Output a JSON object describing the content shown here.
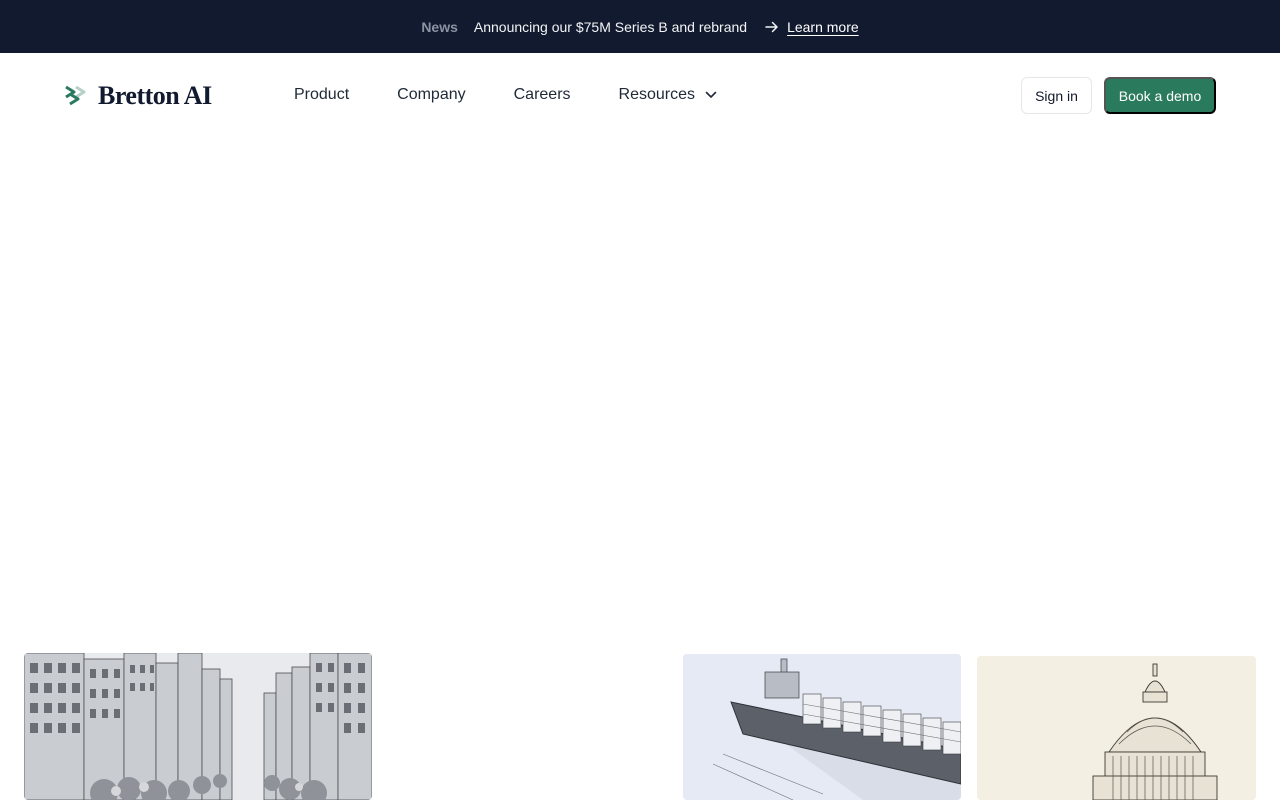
{
  "announcement": {
    "tag": "News",
    "message": "Announcing our $75M Series B and rebrand",
    "link_label": "Learn more",
    "arrow_icon": "arrow-right-icon"
  },
  "brand": {
    "name": "Bretton AI",
    "logo_icon": "double-chevron-logo-icon",
    "accent_color": "#2a7a5e",
    "announcement_bg": "#111a2e"
  },
  "nav": {
    "items": [
      {
        "label": "Product"
      },
      {
        "label": "Company"
      },
      {
        "label": "Careers"
      },
      {
        "label": "Resources",
        "icon": "chevron-down-icon"
      }
    ]
  },
  "actions": {
    "signin_label": "Sign in",
    "demo_label": "Book a demo"
  },
  "gallery": {
    "images": [
      {
        "icon": "city-street-illustration"
      },
      {
        "icon": "container-ship-illustration"
      },
      {
        "icon": "capitol-dome-illustration"
      }
    ]
  }
}
